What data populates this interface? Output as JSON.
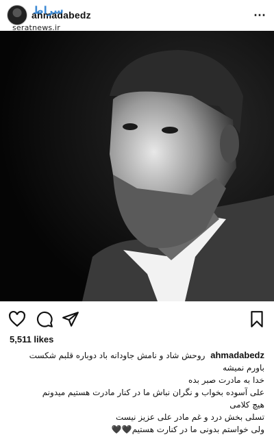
{
  "header": {
    "username": "ahmadabedz",
    "watermark": "seratnews.ir",
    "watermark_logo": "سراط"
  },
  "post": {
    "likes": "5,511 likes",
    "caption_username": "ahmadabedz",
    "caption_lines": [
      "روحش شاد و نامش جاودانه باد دوباره قلبم شکست",
      "باورم نمیشه",
      "خدا به مادرت صبر بده",
      "علی آسوده بخواب و نگران نباش ما در کنار مادرت هستیم  میدونم",
      "هیچ کلامی",
      "تسلی بخش درد و غم مادر  علی عزیز نیست",
      "ولی خواستم بدونی ما در کنارت هستیم🖤🖤"
    ]
  },
  "icons": {
    "more": "more-options-icon",
    "like": "heart-icon",
    "comment": "comment-icon",
    "share": "share-icon",
    "save": "bookmark-icon"
  }
}
